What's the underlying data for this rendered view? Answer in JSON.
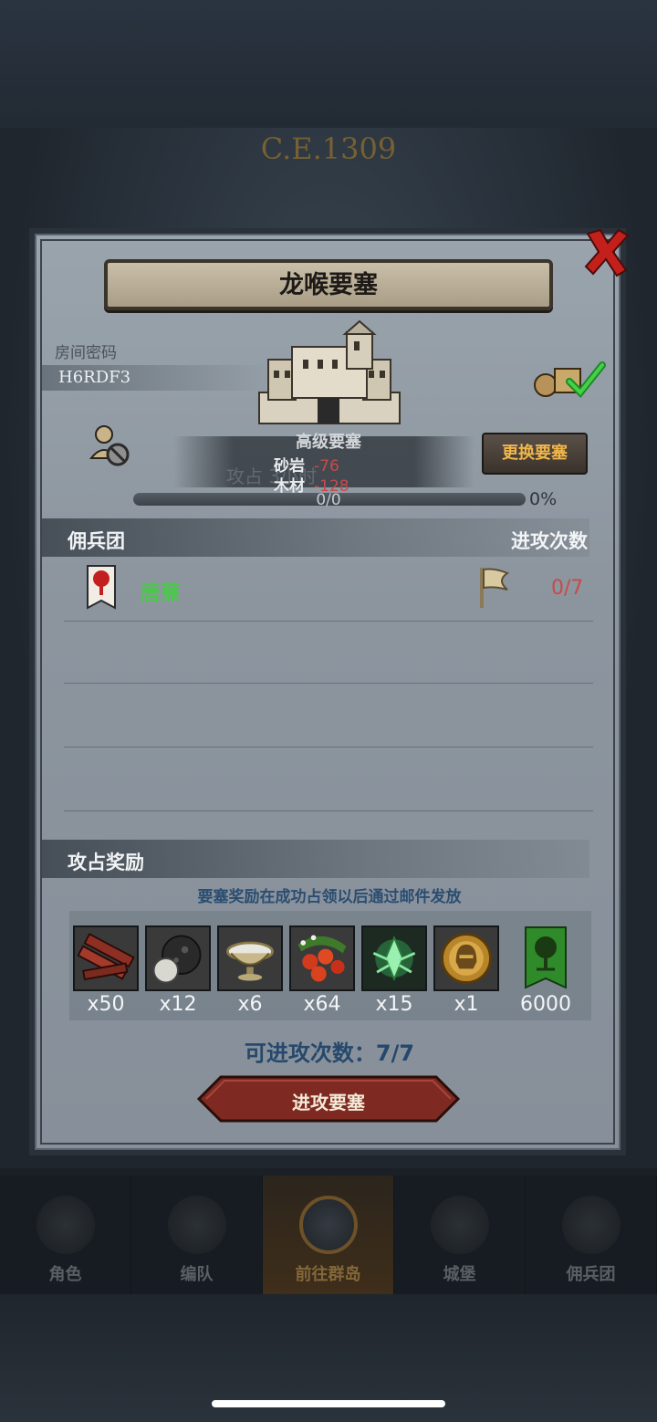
{
  "background": {
    "era": "C.E.1309"
  },
  "modal": {
    "title": "龙喉要塞",
    "room": {
      "label": "房间密码",
      "code": "H6RDF3"
    },
    "fortress": {
      "level": "高级要塞",
      "change_button": "更换要塞",
      "resources": [
        {
          "name": "砂岩",
          "value": "-76"
        },
        {
          "name": "木材",
          "value": "-128"
        }
      ],
      "ghost_text": "攻占                 3小时",
      "progress": {
        "count": "0/0",
        "percent_label": "0%",
        "fraction": 0
      }
    },
    "mercenary_section": {
      "title": "佣兵团",
      "right_label": "进攻次数",
      "rows": [
        {
          "name": "唐蒹",
          "attacks": "0/7"
        }
      ]
    },
    "reward_section": {
      "title": "攻占奖励",
      "note": "要塞奖励在成功占领以后通过邮件发放",
      "items": [
        {
          "icon": "wood-planks-icon",
          "qty": "x50"
        },
        {
          "icon": "stone-ore-icon",
          "qty": "x12"
        },
        {
          "icon": "bowl-icon",
          "qty": "x6"
        },
        {
          "icon": "berries-icon",
          "qty": "x64"
        },
        {
          "icon": "green-crystal-icon",
          "qty": "x15"
        },
        {
          "icon": "helmet-medal-icon",
          "qty": "x1"
        },
        {
          "icon": "tree-banner-icon",
          "qty": "6000"
        }
      ]
    },
    "attacks_remaining": "可进攻次数：7/7",
    "attack_button": "进攻要塞"
  },
  "bottom_nav": {
    "items": [
      {
        "label": "角色",
        "active": false
      },
      {
        "label": "编队",
        "active": false
      },
      {
        "label": "前往群岛",
        "active": true
      },
      {
        "label": "城堡",
        "active": false
      },
      {
        "label": "佣兵团",
        "active": false
      }
    ]
  },
  "colors": {
    "accent_gold": "#f0b64a",
    "merc_name_green": "#4cc84c",
    "negative_red": "#c84a4a",
    "info_blue": "#25486c"
  }
}
